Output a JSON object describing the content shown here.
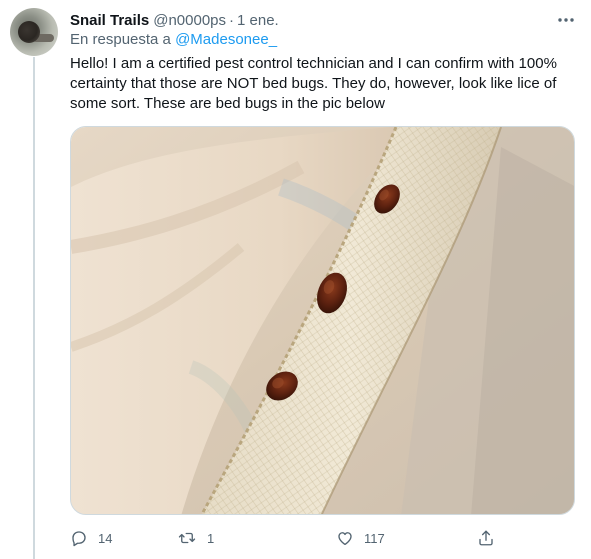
{
  "tweet": {
    "author_name": "Snail Trails",
    "handle": "@n0000ps",
    "separator": "·",
    "date": "1 ene.",
    "reply_prefix": "En respuesta a",
    "reply_to": "@Madesonee_",
    "text": "Hello! I am a certified pest control technician and I can confirm with 100% certainty that those are NOT bed bugs. They do, however, look like lice of some sort. These are bed bugs in the pic below",
    "media_icon": "photo-of-bed-bugs-on-mattress-seam"
  },
  "actions": {
    "reply_count": "14",
    "retweet_count": "1",
    "like_count": "117",
    "icons": [
      "reply-icon",
      "retweet-icon",
      "like-icon",
      "share-icon"
    ]
  },
  "colors": {
    "accent": "#1d9bf0",
    "muted": "#536471",
    "text": "#0f1419",
    "border": "#cfd9de"
  }
}
